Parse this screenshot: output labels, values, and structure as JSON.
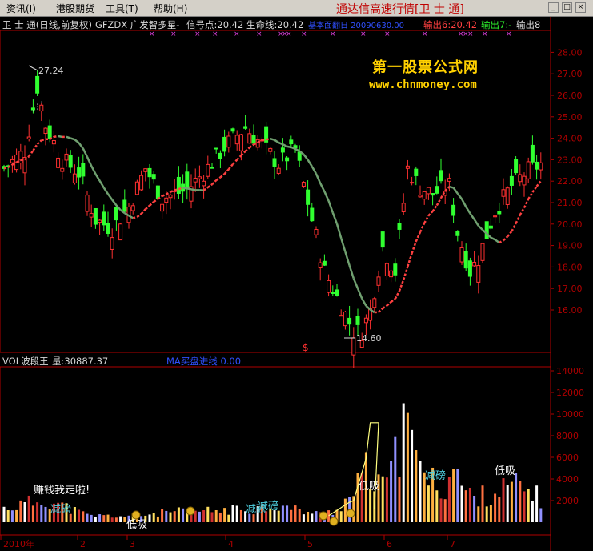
{
  "menu": {
    "items": [
      "资讯(I)",
      "港股期货",
      "工具(T)",
      "帮助(H)"
    ],
    "quote_title": "通达信高速行情[卫 士 通]",
    "win_buttons": [
      "_",
      "□",
      "×"
    ]
  },
  "info_bar": {
    "stock": "卫 士 通(日线,前复权)",
    "indicator": "GFZDX 广发智多星-",
    "signal": "信号点:20.42",
    "lifeline": "生命线:20.42",
    "date_text": "基本面翻日 20090630.00",
    "out6": "输出6:20.42",
    "out7": "输出7:-",
    "out8": "输出8"
  },
  "watermark": {
    "title": "第一股票公式网",
    "url": "www.chnmoney.com"
  },
  "price_axis": {
    "ticks": [
      "28.00",
      "27.00",
      "26.00",
      "25.00",
      "24.00",
      "23.00",
      "22.00",
      "21.00",
      "20.00",
      "19.00",
      "18.00",
      "17.00",
      "16.00"
    ]
  },
  "price_annotations": {
    "high": "27.24",
    "low": "14.60",
    "dollar": "$"
  },
  "vol_bar": {
    "name": "VOL波段王",
    "volume": "量:30887.37",
    "ma_text": "MA买盘进线 0.00"
  },
  "vol_axis": {
    "ticks": [
      "14000",
      "12000",
      "10000",
      "8000",
      "6000",
      "4000",
      "2000"
    ]
  },
  "vol_annotations": [
    {
      "text": "赚钱我走啦!",
      "color": "#ffffff"
    },
    {
      "text": "减磅",
      "color": "#4fd0e0"
    },
    {
      "text": "低吸",
      "color": "#ffffff"
    },
    {
      "text": "减磅",
      "color": "#4fd0e0"
    },
    {
      "text": "减磅",
      "color": "#4fd0e0"
    },
    {
      "text": "低吸",
      "color": "#ffffff"
    },
    {
      "text": "减磅",
      "color": "#4fd0e0"
    },
    {
      "text": "低吸",
      "color": "#ffffff"
    }
  ],
  "date_axis": {
    "labels": [
      "2010年",
      "2",
      "3",
      "4",
      "5",
      "6",
      "7"
    ]
  },
  "colors": {
    "up": "#ff3030",
    "down": "#30ff30",
    "axis": "#b00000",
    "text_white": "#d8d8d8",
    "signal_yellow": "#ffff00",
    "blue": "#3050ff",
    "magenta": "#e040e0"
  }
}
